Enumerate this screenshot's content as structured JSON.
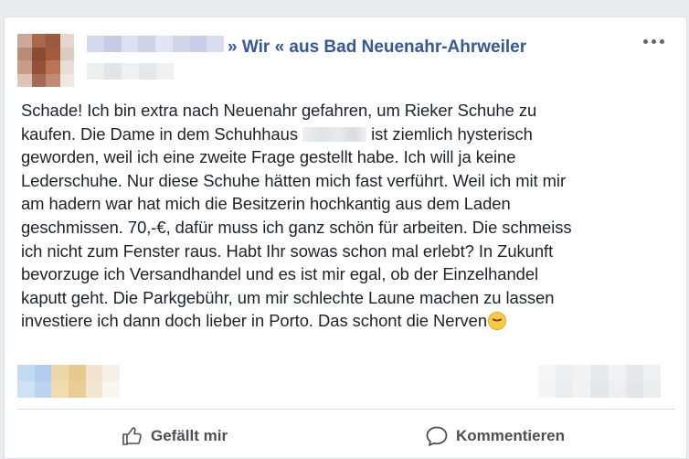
{
  "post": {
    "group_name": "» Wir « aus Bad Neuenahr-Ahrweiler",
    "text_lines": [
      "Schade! Ich bin extra nach Neuenahr gefahren, um Rieker Schuhe zu",
      "kaufen. Die Dame in dem Schuhhaus",
      "ist ziemlich hysterisch",
      "geworden, weil ich eine zweite Frage gestellt habe. Ich will ja keine",
      "Lederschuhe. Nur diese Schuhe hätten mich fast verführt. Weil ich mit mir",
      "am hadern war hat mich die Besitzerin hochkantig aus dem Laden",
      "geschmissen. 70,-€, dafür muss ich ganz schön für arbeiten. Die schmeiss",
      "ich nicht zum Fenster raus. Habt Ihr sowas schon mal erlebt? In Zukunft",
      "bevorzuge ich Versandhandel und es ist mir egal, ob der Einzelhandel",
      "kaputt geht. Die Parkgebühr, um mir schlechte Laune machen zu lassen",
      "investiere ich dann doch lieber in Porto. Das schont die Nerven"
    ],
    "emoji_icon": "persevering-face-icon"
  },
  "actions": {
    "like_label": "Gefällt mir",
    "comment_label": "Kommentieren",
    "like_icon": "thumbs-up-icon",
    "comment_icon": "speech-bubble-icon"
  },
  "colors": {
    "link": "#365899",
    "text": "#1d2129",
    "action_text": "#4b4f56",
    "background": "#e9ebee"
  }
}
